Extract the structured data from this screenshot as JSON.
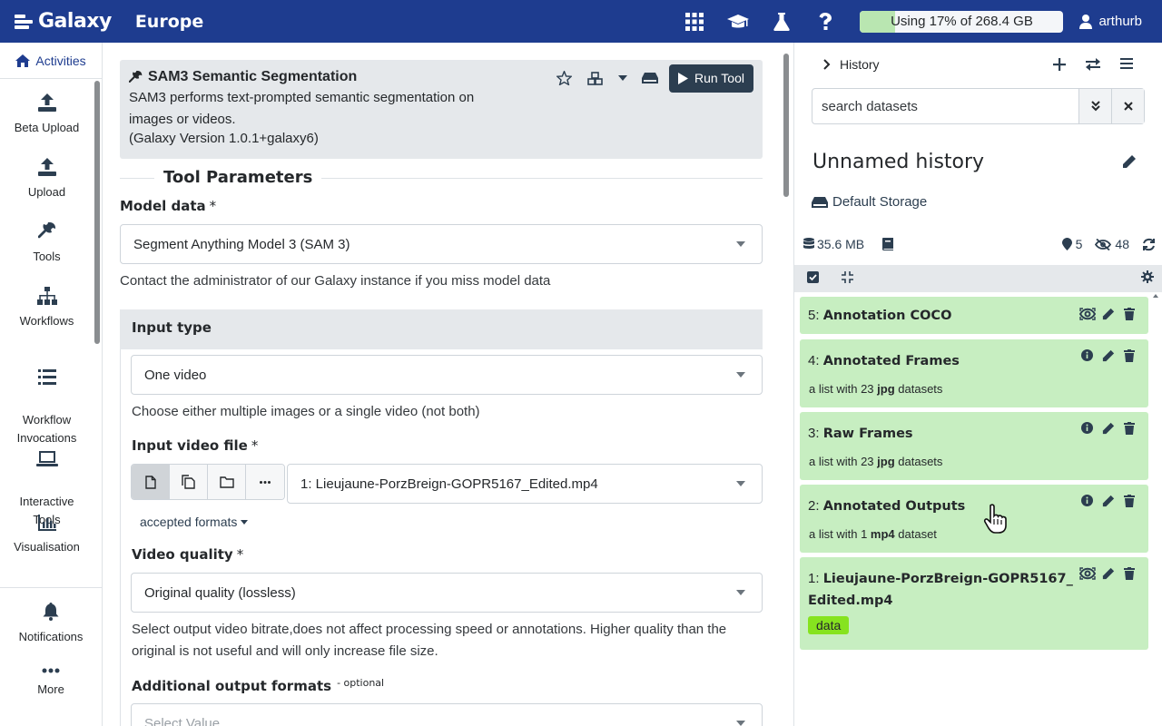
{
  "masthead": {
    "brand": "Galaxy",
    "subtitle": "Europe",
    "icons": [
      "grid-icon",
      "graduation-cap-icon",
      "flask-icon",
      "help-icon"
    ],
    "quota_text": "Using 17% of 268.4 GB",
    "quota_percent": 17,
    "username": "arthurb",
    "bg_color": "#1e3c8f"
  },
  "activity": {
    "top_label": "Activities",
    "items": [
      {
        "label": "Beta Upload",
        "icon": "upload-icon"
      },
      {
        "label": "Upload",
        "icon": "upload-icon"
      },
      {
        "label": "Tools",
        "icon": "wrench-icon"
      },
      {
        "label": "Workflows",
        "icon": "sitemap-icon"
      },
      {
        "label": "Workflow\nInvocations",
        "icon": "list-icon"
      },
      {
        "label": "Interactive\nTools",
        "icon": "laptop-icon"
      },
      {
        "label": "Visualisation",
        "icon": "chart-icon"
      }
    ],
    "bottom": [
      {
        "label": "Notifications",
        "icon": "bell-icon"
      },
      {
        "label": "More",
        "icon": "ellipsis-icon"
      }
    ]
  },
  "tool": {
    "name": "SAM3 Semantic Segmentation",
    "description": "SAM3 performs text-prompted semantic segmentation on images or videos.",
    "version": "(Galaxy Version 1.0.1+galaxy6)",
    "run_label": "Run Tool"
  },
  "form": {
    "section_title": "Tool Parameters",
    "model_label": "Model data",
    "model_value": "Segment Anything Model 3 (SAM 3)",
    "model_help": "Contact the administrator of our Galaxy instance if you miss model data",
    "input_type_label": "Input type",
    "input_type_value": "One video",
    "input_type_help": "Choose either multiple images or a single video (not both)",
    "video_label": "Input video file",
    "video_value": "1: Lieujaune-PorzBreign-GOPR5167_Edited.mp4",
    "accepted_formats": "accepted formats",
    "quality_label": "Video quality",
    "quality_value": "Original quality (lossless)",
    "quality_help": "Select output video bitrate,does not affect processing speed or annotations. Higher quality than the original is not useful and will only increase file size.",
    "additional_label": "Additional output formats",
    "optional_tag": "- optional",
    "additional_placeholder": "Select Value",
    "required_mark": "*"
  },
  "history": {
    "header": "History",
    "search_placeholder": "search datasets",
    "name": "Unnamed history",
    "storage": "Default Storage",
    "size": "35.6 MB",
    "shown_count": "5",
    "hidden_count": "48",
    "datasets": [
      {
        "hid": "5:",
        "name": "Annotation COCO",
        "sub_pre": "",
        "sub_bold": "",
        "sub_post": ""
      },
      {
        "hid": "4:",
        "name": "Annotated Frames",
        "sub_pre": "a list with 23 ",
        "sub_bold": "jpg",
        "sub_post": " datasets"
      },
      {
        "hid": "3:",
        "name": "Raw Frames",
        "sub_pre": "a list with 23 ",
        "sub_bold": "jpg",
        "sub_post": " datasets"
      },
      {
        "hid": "2:",
        "name": "Annotated Outputs",
        "sub_pre": "a list with 1 ",
        "sub_bold": "mp4",
        "sub_post": " dataset"
      },
      {
        "hid": "1:",
        "name": "Lieujaune-PorzBreign-GOPR5167_Edited.mp4",
        "tag": "data"
      }
    ],
    "ok_color": "#c7eec1"
  }
}
